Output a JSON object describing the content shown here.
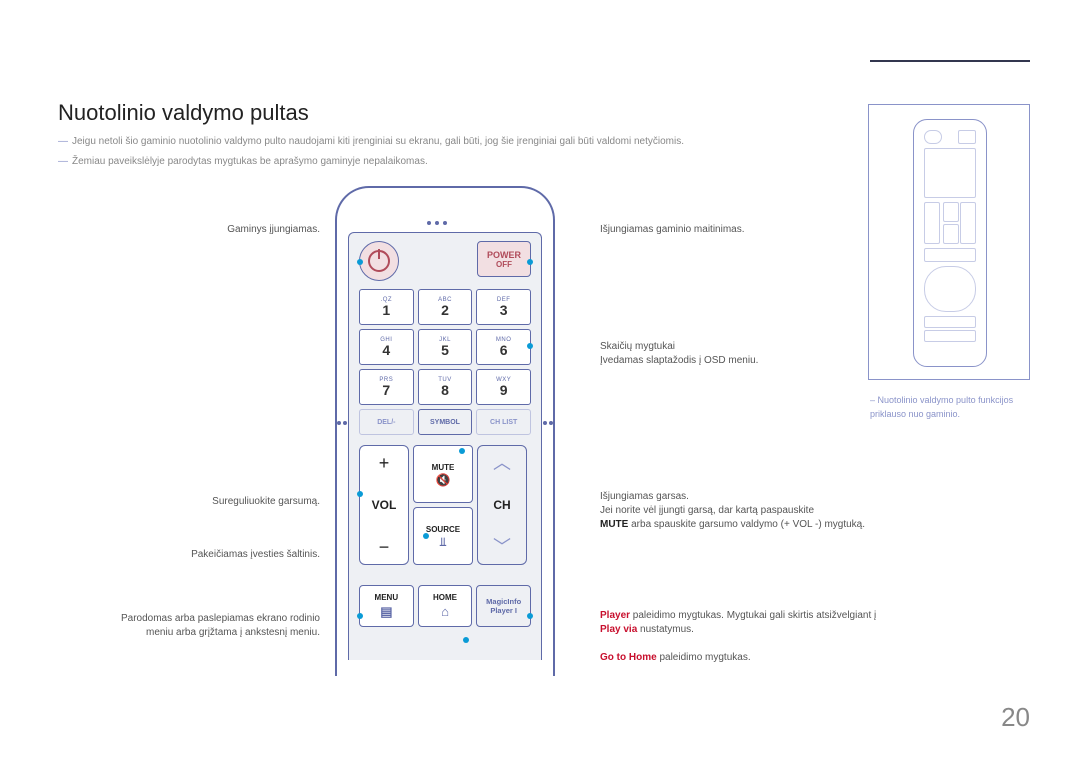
{
  "title": "Nuotolinio valdymo pultas",
  "notes": {
    "n1": "Jeigu netoli šio gaminio nuotolinio valdymo pulto naudojami kiti įrenginiai su ekranu, gali būti, jog šie įrenginiai gali būti valdomi netyčiomis.",
    "n2": "Žemiau paveikslėlyje parodytas mygtukas be aprašymo gaminyje nepalaikomas."
  },
  "left": {
    "power": "Gaminys įjungiamas.",
    "volume": "Sureguliuokite garsumą.",
    "source": "Pakeičiamas įvesties šaltinis.",
    "menu_l1": "Parodomas arba paslepiamas ekrano rodinio",
    "menu_l2": "meniu arba grįžtama į ankstesnį meniu."
  },
  "right": {
    "poweroff": "Išjungiamas gaminio maitinimas.",
    "numbers_l1": "Skaičių mygtukai",
    "numbers_l2": "Įvedamas slaptažodis į OSD meniu.",
    "mute_l1": "Išjungiamas garsas.",
    "mute_l2": "Jei norite vėl įjungti garsą, dar kartą paspauskite",
    "mute_l3pre": "MUTE",
    "mute_l3": " arba spauskite garsumo valdymo (+ VOL -) mygtuką.",
    "player_red": "Player",
    "player_rest": " paleidimo mygtukas. Mygtukai gali skirtis atsižvelgiant į ",
    "player_red2": "Play via",
    "player_rest2": " nustatymus.",
    "home_red": "Go to Home",
    "home_rest": " paleidimo mygtukas."
  },
  "keys": {
    "power": "POWER",
    "off": "OFF",
    "subs": [
      ".QZ",
      "ABC",
      "DEF",
      "GHI",
      "JKL",
      "MNO",
      "PRS",
      "TUV",
      "WXY"
    ],
    "nums": [
      "1",
      "2",
      "3",
      "4",
      "5",
      "6",
      "7",
      "8",
      "9"
    ],
    "del": "DEL/-",
    "symbol": "SYMBOL",
    "chlist": "CH LIST",
    "plus": "+",
    "minus": "−",
    "vol": "VOL",
    "ch": "CH",
    "mute": "MUTE",
    "source": "SOURCE",
    "menu": "MENU",
    "home": "HOME",
    "magic1": "MagicInfo",
    "magic2": "Player I"
  },
  "sidebar_note": "Nuotolinio valdymo pulto funkcijos priklauso nuo gaminio.",
  "pagenum": "20"
}
